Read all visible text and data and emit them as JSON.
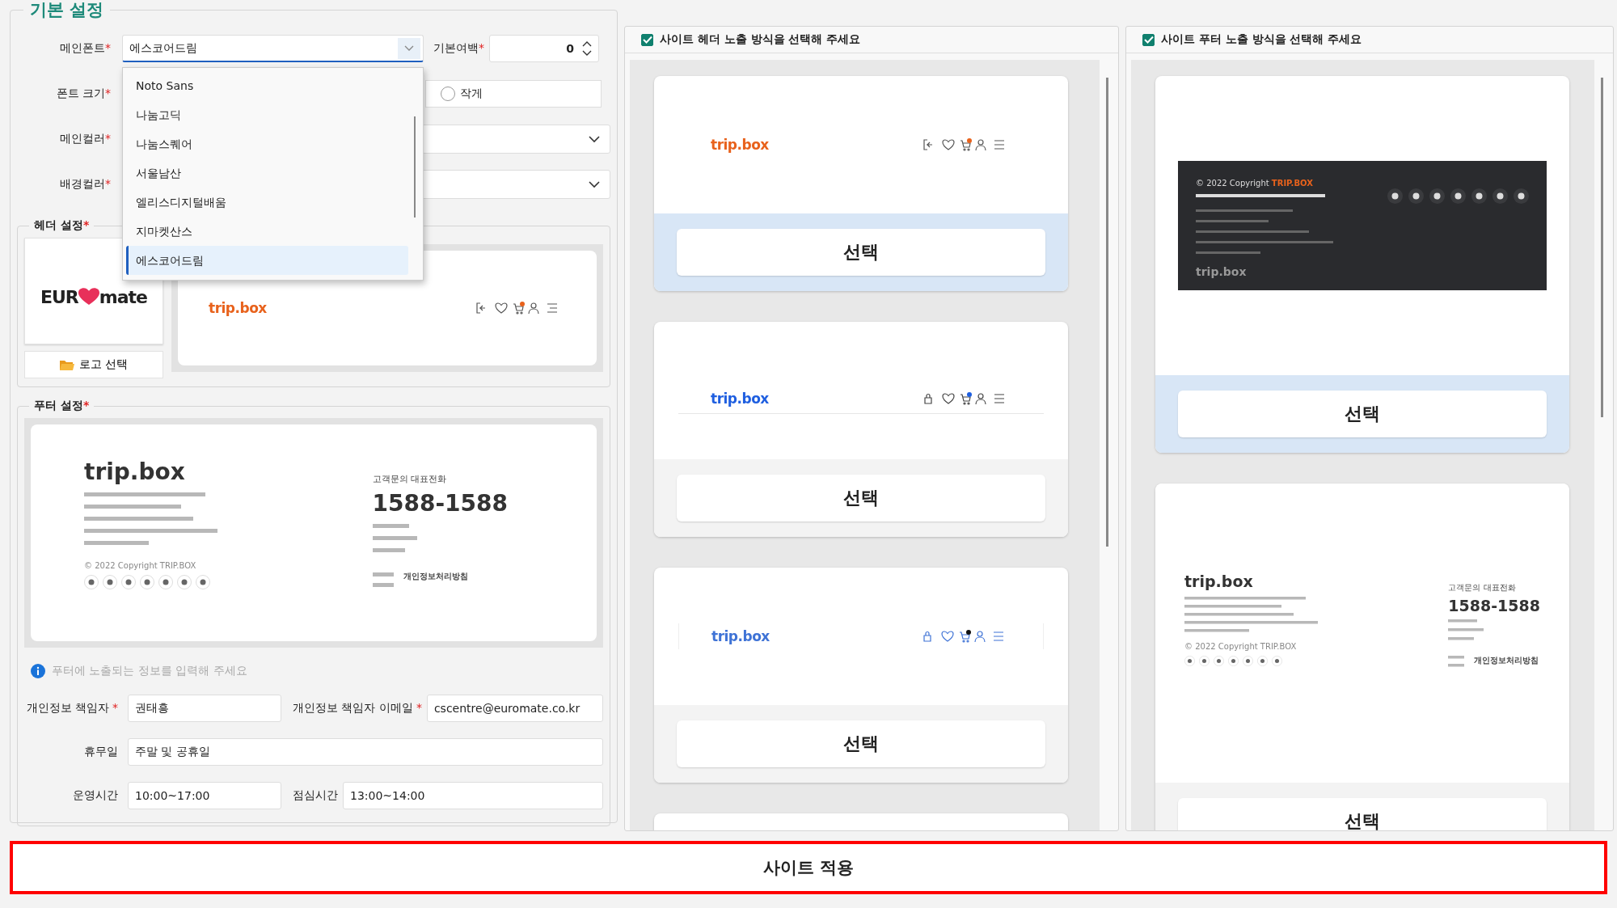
{
  "basic_settings": {
    "title": "기본 설정",
    "main_font": {
      "label": "메인폰트",
      "required_mark": "*",
      "value": "에스코어드림",
      "expanded": true,
      "options": [
        {
          "label": "Noto Sans",
          "selected": false
        },
        {
          "label": "나눔고딕",
          "selected": false
        },
        {
          "label": "나눔스퀘어",
          "selected": false
        },
        {
          "label": "서울남산",
          "selected": false
        },
        {
          "label": "엘리스디지털배움",
          "selected": false
        },
        {
          "label": "지마켓산스",
          "selected": false
        },
        {
          "label": "에스코어드림",
          "selected": true
        }
      ]
    },
    "margin": {
      "label": "기본여백",
      "required_mark": "*",
      "value": "0"
    },
    "font_size": {
      "label": "폰트 크기",
      "required_mark": "*",
      "options": [
        {
          "label": "작게",
          "selected": false
        }
      ]
    },
    "main_color": {
      "label": "메인컬러",
      "required_mark": "*"
    },
    "background_color": {
      "label": "배경컬러",
      "required_mark": "*"
    },
    "header_settings": {
      "title": "헤더 설정",
      "required_mark": "*",
      "logo": [
        "EUR",
        "mate"
      ],
      "logo_button": "로고 선택",
      "preview": {
        "brand": "trip.box"
      }
    },
    "footer_settings": {
      "title": "푸터 설정",
      "required_mark": "*",
      "preview": {
        "brand": "trip.box",
        "copyright": "© 2022 Copyright TRIP.BOX",
        "cs_label": "고객문의 대표전화",
        "phone": "1588-1588",
        "policy": "개인정보처리방침"
      },
      "hint": "푸터에 노출되는 정보를 입력해 주세요",
      "rows": [
        [
          {
            "label": "개인정보 책임자",
            "required_mark": "*",
            "value": "권태흥"
          },
          {
            "label": "개인정보 책임자 이메일",
            "required_mark": "*",
            "value": "cscentre@euromate.co.kr"
          }
        ],
        [
          {
            "label": "휴무일",
            "value": "주말 및 공휴일"
          }
        ],
        [
          {
            "label": "운영시간",
            "value": "10:00~17:00"
          },
          {
            "label": "점심시간",
            "value": "13:00~14:00"
          }
        ]
      ]
    }
  },
  "header_panel": {
    "title": "사이트 헤더 노출 방식을 선택해 주세요",
    "checked": true,
    "options": [
      {
        "kind": "classic",
        "brand": "trip.box",
        "button": "선택",
        "selected": true
      },
      {
        "kind": "underline",
        "brand": "trip.box",
        "button": "선택",
        "selected": false
      },
      {
        "kind": "divided",
        "brand": "trip.box",
        "button": "선택",
        "selected": false
      },
      {
        "kind": "empty"
      }
    ]
  },
  "footer_panel": {
    "title": "사이트 푸터 노출 방식을 선택해 주세요",
    "checked": true,
    "options": [
      {
        "kind": "dark",
        "copyright": "© 2022 Copyright",
        "brand_mark": "TRIP.BOX",
        "brand": "trip.box",
        "button": "선택",
        "selected": true
      },
      {
        "kind": "light",
        "brand": "trip.box",
        "copyright": "© 2022 Copyright TRIP.BOX",
        "cs_label": "고객문의 대표전화",
        "phone": "1588-1588",
        "policy": "개인정보처리방침",
        "button": "선택",
        "selected": false
      }
    ]
  },
  "apply_button": "사이트 적용"
}
